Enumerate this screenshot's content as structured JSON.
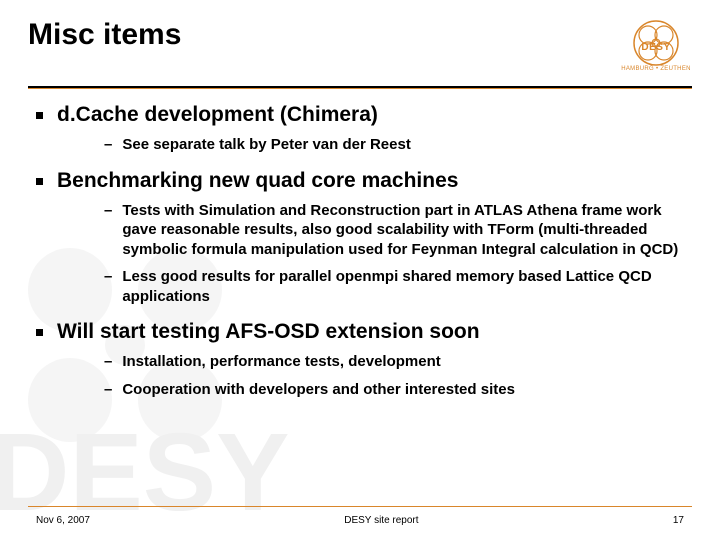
{
  "title": "Misc items",
  "logo": {
    "label": "DESY",
    "sub": "HAMBURG • ZEUTHEN"
  },
  "bullets": [
    {
      "text": "d.Cache development (Chimera)",
      "children": [
        {
          "text": "See separate talk by Peter van der Reest"
        }
      ]
    },
    {
      "text": "Benchmarking new quad core machines",
      "children": [
        {
          "text": "Tests with Simulation and Reconstruction part in ATLAS Athena frame work gave reasonable results, also good scalability with TForm (multi-threaded symbolic formula manipulation used for Feynman Integral calculation in QCD)"
        },
        {
          "text": "Less good results for parallel openmpi shared memory based Lattice QCD applications"
        }
      ]
    },
    {
      "text": "Will start testing AFS-OSD extension soon",
      "children": [
        {
          "text": "Installation, performance tests, development"
        },
        {
          "text": "Cooperation with developers and other interested sites"
        }
      ]
    }
  ],
  "footer": {
    "date": "Nov 6, 2007",
    "center": "DESY site report",
    "page": "17"
  }
}
